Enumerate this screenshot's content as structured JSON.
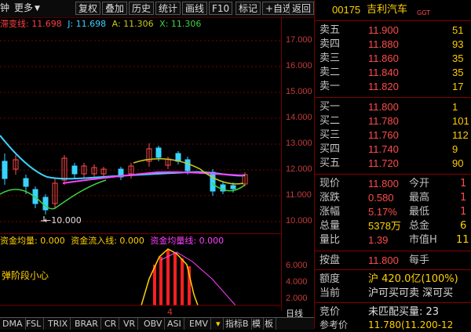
{
  "toolbar": {
    "left_labels": [
      "钟",
      "更多"
    ],
    "buttons": [
      "复权",
      "叠加",
      "历史",
      "统计",
      "画线",
      "F10",
      "标记",
      "+自选",
      "返回"
    ]
  },
  "main_legend": [
    {
      "text": "滞变线: 11.698",
      "color": "#ff4040"
    },
    {
      "text": "J: 11.698",
      "color": "#39d3ff"
    },
    {
      "text": "A: 11.306",
      "color": "#c8c820"
    },
    {
      "text": "X: 11.306",
      "color": "#3fd43f"
    }
  ],
  "price_ticks": [
    "17.000",
    "16.000",
    "15.000",
    "14.000",
    "13.000",
    "12.000",
    "11.000",
    "10.000"
  ],
  "low_marker": "10.000",
  "sub_legend": [
    {
      "text": "资金均量: 0.000",
      "color": "#ffd200"
    },
    {
      "text": "资金流入线: 0.000",
      "color": "#ffd200"
    },
    {
      "text": "资金均量线: 0.000",
      "color": "#ff40ff"
    }
  ],
  "sub_text": "弹阶段小心",
  "sub_ticks": [
    "6.000",
    "4.000",
    "2.000"
  ],
  "date_axis_label": "日线",
  "date_marker": "4",
  "bottom_tabs": [
    "DMA",
    "FSL",
    "TRIX",
    "BRAR",
    "CR",
    "VR",
    "OBV",
    "ASI",
    "EMV",
    "指标B",
    "模",
    "板"
  ],
  "quote": {
    "code": "00175",
    "name": "吉利汽车",
    "suffix": "GGT",
    "asks": [
      {
        "label": "卖五",
        "price": "11.900",
        "vol": "51"
      },
      {
        "label": "卖四",
        "price": "11.880",
        "vol": "93"
      },
      {
        "label": "卖三",
        "price": "11.860",
        "vol": "35"
      },
      {
        "label": "卖二",
        "price": "11.840",
        "vol": "35"
      },
      {
        "label": "卖一",
        "price": "11.820",
        "vol": "17"
      }
    ],
    "bids": [
      {
        "label": "买一",
        "price": "11.800",
        "vol": "1"
      },
      {
        "label": "买二",
        "price": "11.780",
        "vol": "101"
      },
      {
        "label": "买三",
        "price": "11.760",
        "vol": "112"
      },
      {
        "label": "买四",
        "price": "11.740",
        "vol": "9"
      },
      {
        "label": "买五",
        "price": "11.720",
        "vol": "90"
      }
    ],
    "stats": [
      {
        "l1": "现价",
        "v1": "11.800",
        "c1": "red",
        "l2": "今开",
        "v2": "1"
      },
      {
        "l1": "涨跌",
        "v1": "0.580",
        "c1": "red",
        "l2": "最高",
        "v2": "1"
      },
      {
        "l1": "涨幅",
        "v1": "5.17%",
        "c1": "red",
        "l2": "最低",
        "v2": "1"
      },
      {
        "l1": "总量",
        "v1": "5378万",
        "c1": "yellow",
        "l2": "总金",
        "v2": "6"
      },
      {
        "l1": "量比",
        "v1": "1.39",
        "c1": "red",
        "l2": "市值H",
        "v2": "11"
      }
    ],
    "close": {
      "l1": "按盘",
      "v1": "11.800",
      "l2": "每手",
      "v2": ""
    },
    "quota": {
      "label": "额度",
      "value": "沪 420.0亿(100%)",
      "extra": "42"
    },
    "current": {
      "label": "当前",
      "value": "沪可买可卖 深可买"
    },
    "bid_auction": {
      "label": "竞价",
      "value": "未匹配买量: 23"
    },
    "ref_price": {
      "label": "参考价",
      "value": "11.780(11.200-12"
    }
  },
  "colors": {
    "up": "#ff4b4b",
    "down": "#3fd43f",
    "grid_red": "#700"
  }
}
